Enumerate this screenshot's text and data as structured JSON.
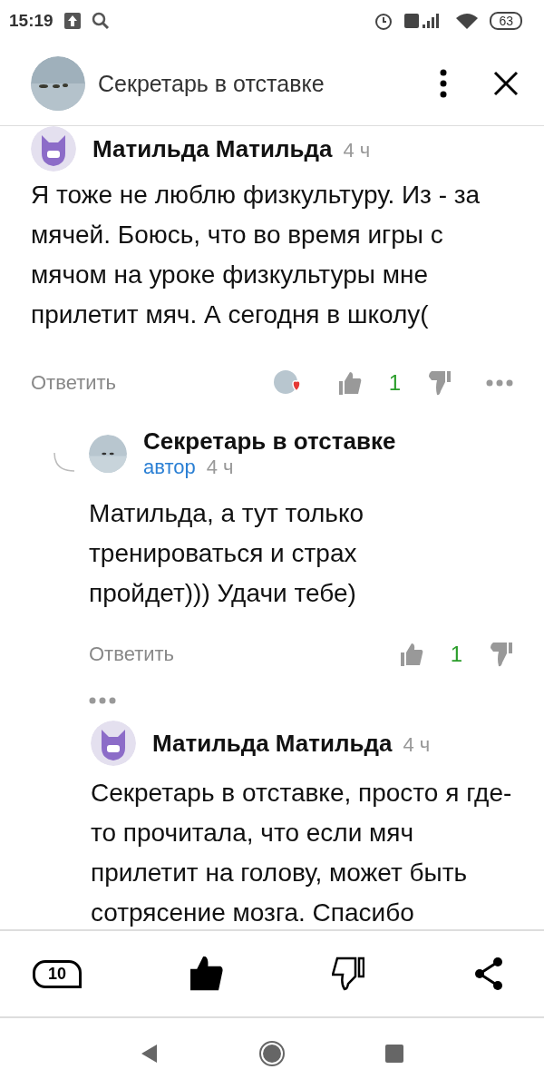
{
  "status_bar": {
    "time": "15:19",
    "battery": "63"
  },
  "header": {
    "title": "Секретарь в отставке"
  },
  "comments": [
    {
      "avatar": {
        "kind": "fox"
      },
      "author": "Матильда Матильда",
      "time": "4 ч",
      "text": "Я тоже не люблю физкультуру. Из - за мячей. Боюсь, что во время игры с мячом на уроке физкультуры мне прилетит мяч. А сегодня в школу(",
      "reply": "Ответить",
      "likes": "1",
      "reacted": true,
      "reply_to": false,
      "more_below": false
    },
    {
      "author": "Секретарь в отставке",
      "badge": "автор",
      "time": "4 ч",
      "text": "Матильда, а тут только тренироваться и страх пройдет))) Удачи тебе)",
      "reply": "Ответить",
      "likes": "1",
      "reacted": false,
      "reply_to": true,
      "more_below": true
    },
    {
      "avatar": {
        "kind": "fox"
      },
      "author": "Матильда Матильда",
      "time": "4 ч",
      "text": "Секретарь в отставке, просто я где- то прочитала, что если мяч прилетит на голову, может быть сотрясение мозга. Спасибо",
      "reply_to": false
    }
  ],
  "bottom_bar": {
    "comments_count": "10",
    "liked": true,
    "disliked": false
  }
}
